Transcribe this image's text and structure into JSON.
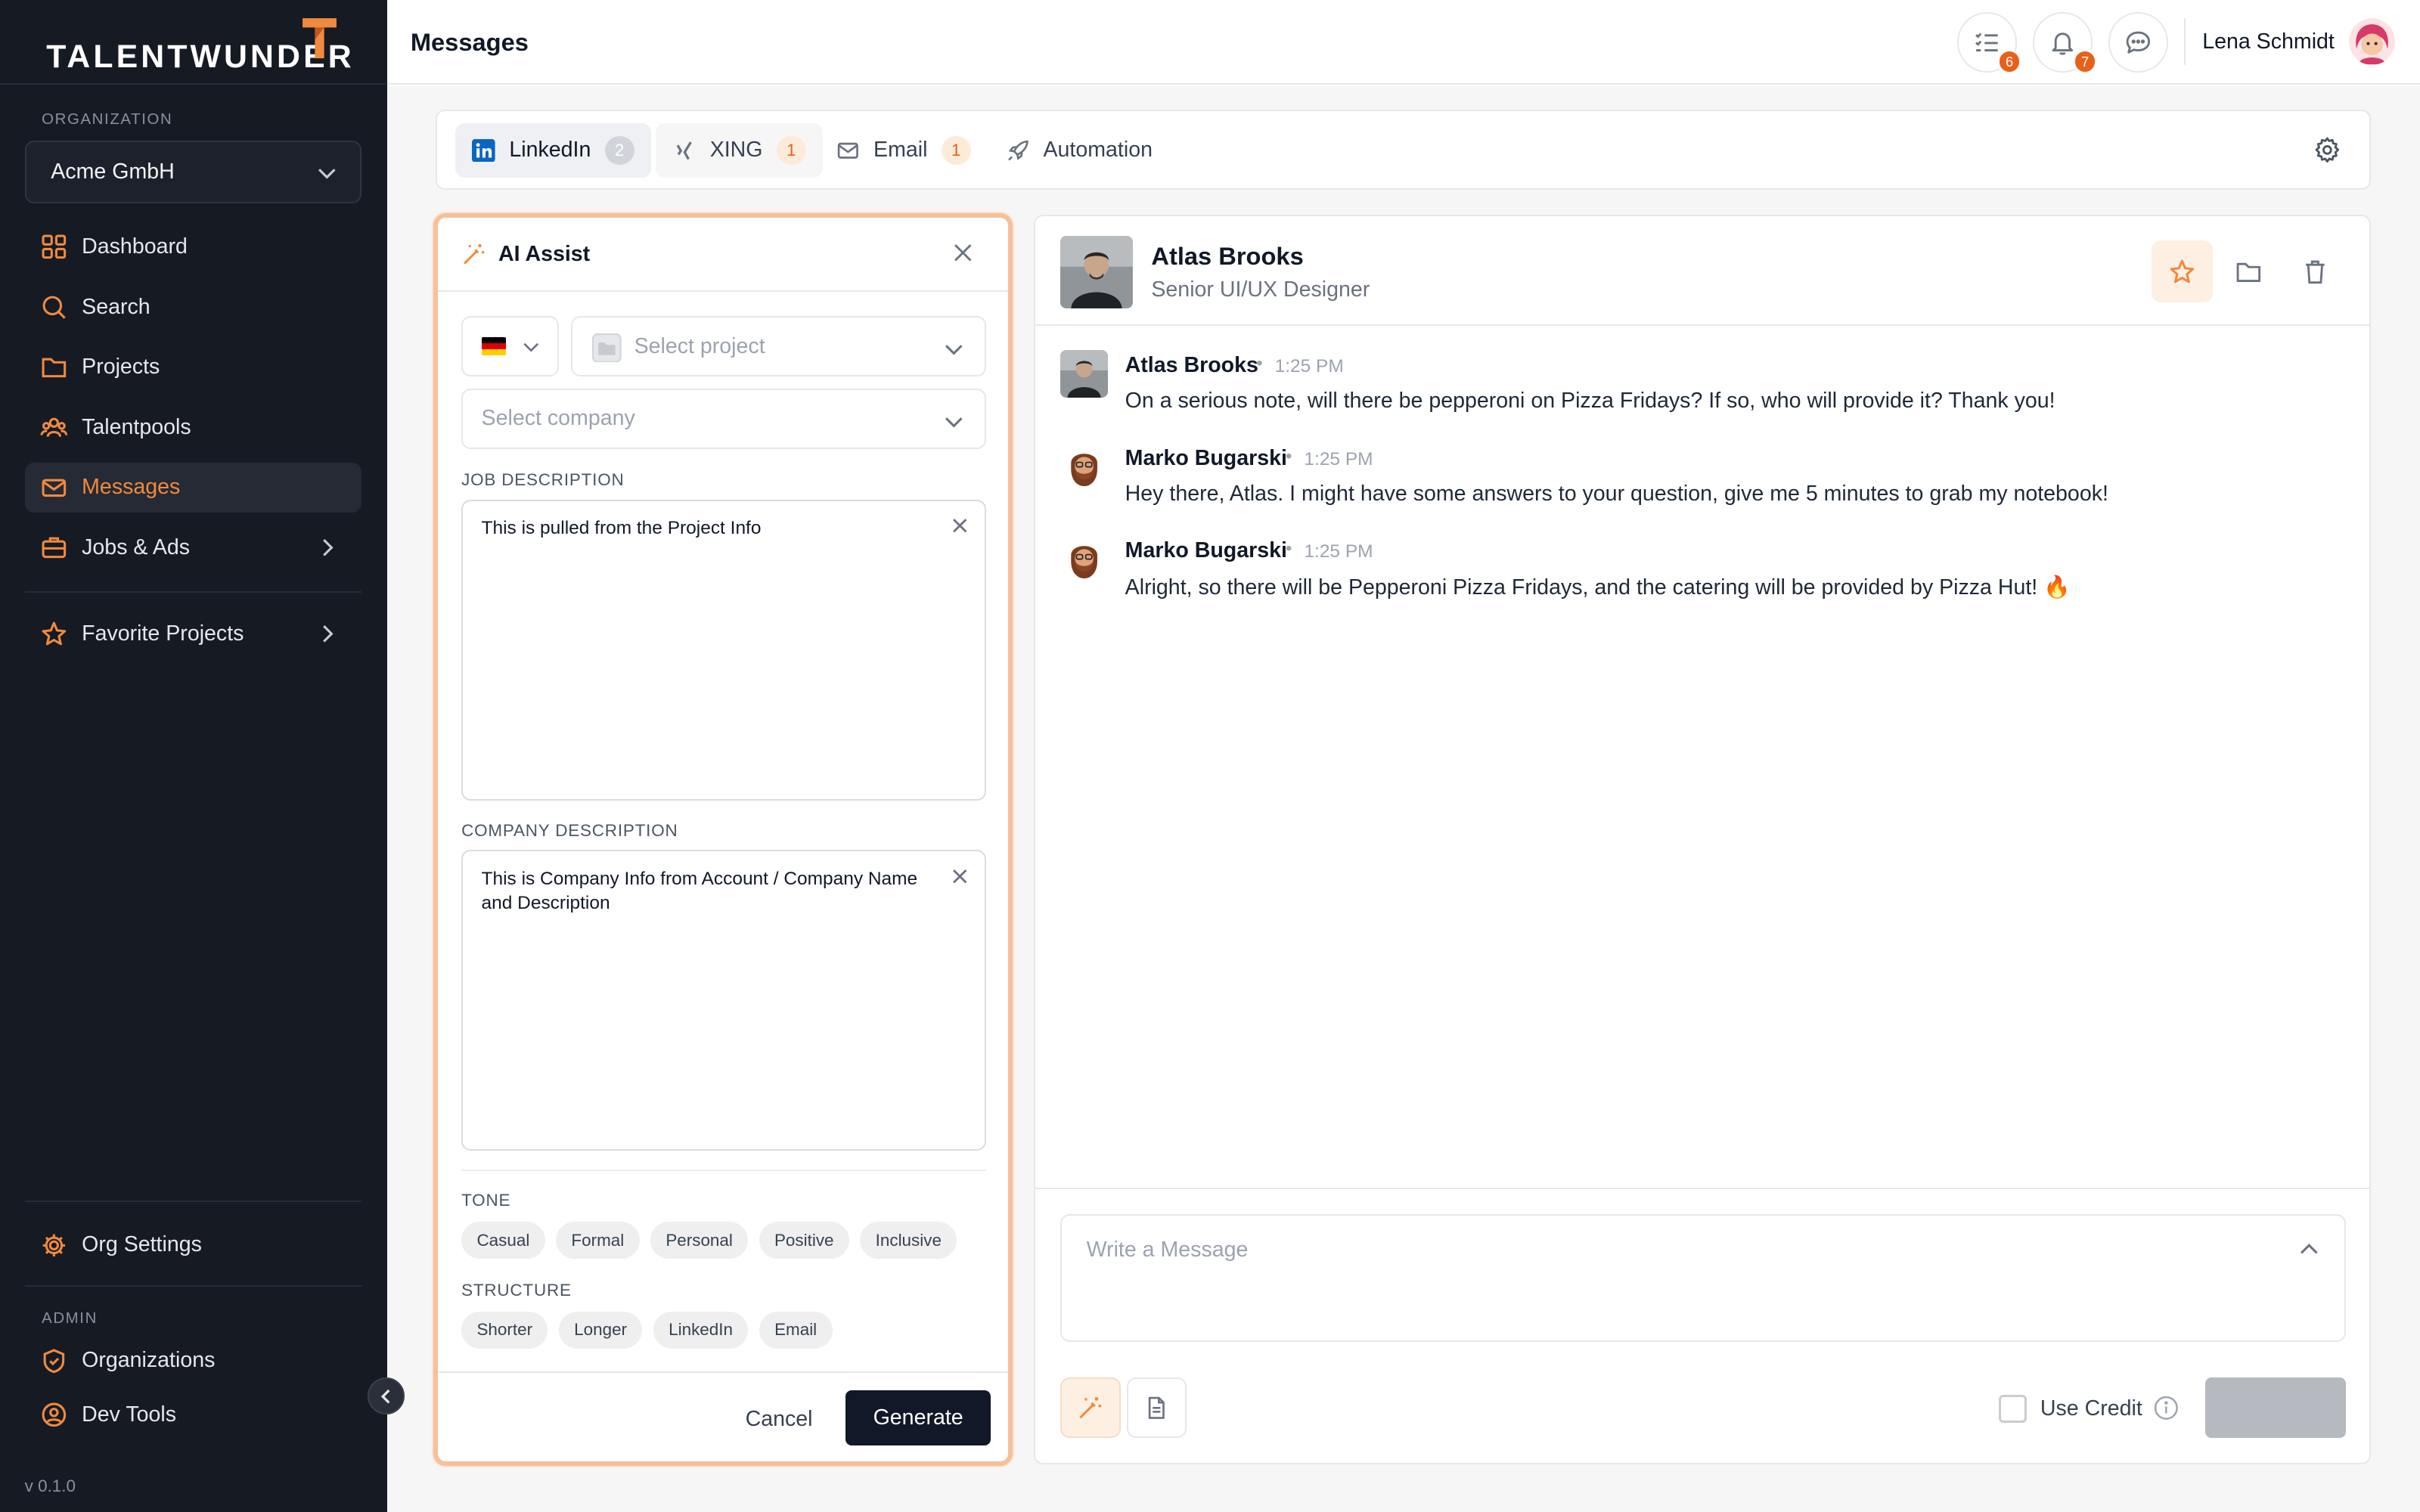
{
  "brand": {
    "name": "TALENTWUNDER",
    "accent": "#f08a3e"
  },
  "sidebar": {
    "org_label": "ORGANIZATION",
    "org_value": "Acme GmbH",
    "items": [
      {
        "label": "Dashboard",
        "icon": "dashboard-icon"
      },
      {
        "label": "Search",
        "icon": "search-icon"
      },
      {
        "label": "Projects",
        "icon": "folder-icon"
      },
      {
        "label": "Talentpools",
        "icon": "users-icon"
      },
      {
        "label": "Messages",
        "icon": "mail-icon",
        "active": true
      },
      {
        "label": "Jobs & Ads",
        "icon": "briefcase-icon"
      },
      {
        "label": "Favorite Projects",
        "icon": "star-icon"
      },
      {
        "label": "Org Settings",
        "icon": "gear-icon"
      }
    ],
    "admin_label": "ADMIN",
    "admin_items": [
      {
        "label": "Organizations",
        "icon": "shield-icon"
      },
      {
        "label": "Dev Tools",
        "icon": "user-circle-icon"
      }
    ],
    "version": "v 0.1.0"
  },
  "header": {
    "title": "Messages",
    "tasks_badge": "6",
    "notifications_badge": "7",
    "user_name": "Lena Schmidt"
  },
  "tabs": [
    {
      "label": "LinkedIn",
      "count": "2"
    },
    {
      "label": "XING",
      "count": "1"
    },
    {
      "label": "Email",
      "count": "1"
    },
    {
      "label": "Automation"
    }
  ],
  "ai_assist": {
    "title": "AI Assist",
    "project_placeholder": "Select project",
    "company_placeholder": "Select company",
    "job_label": "JOB DESCRIPTION",
    "job_value": "This is pulled from the Project Info",
    "company_label": "COMPANY DESCRIPTION",
    "company_value": "This is Company Info from Account / Company Name and Description",
    "tone_label": "TONE",
    "tones": [
      "Casual",
      "Formal",
      "Personal",
      "Positive",
      "Inclusive"
    ],
    "structure_label": "STRUCTURE",
    "structures": [
      "Shorter",
      "Longer",
      "LinkedIn",
      "Email"
    ],
    "cancel_label": "Cancel",
    "generate_label": "Generate"
  },
  "conversation": {
    "contact_name": "Atlas Brooks",
    "contact_role": "Senior UI/UX Designer",
    "messages": [
      {
        "author": "Atlas Brooks",
        "time": "1:25 PM",
        "text": "On a serious note, will there be pepperoni on Pizza Fridays? If so, who will provide it? Thank you!"
      },
      {
        "author": "Marko Bugarski",
        "time": "1:25 PM",
        "text": "Hey there, Atlas. I might have some answers to your question, give me 5 minutes to grab my notebook!"
      },
      {
        "author": "Marko Bugarski",
        "time": "1:25 PM",
        "text": "Alright, so there will be Pepperoni Pizza Fridays, and the catering will be provided by Pizza Hut! 🔥"
      }
    ],
    "composer_placeholder": "Write a Message",
    "use_credit_label": "Use Credit"
  }
}
